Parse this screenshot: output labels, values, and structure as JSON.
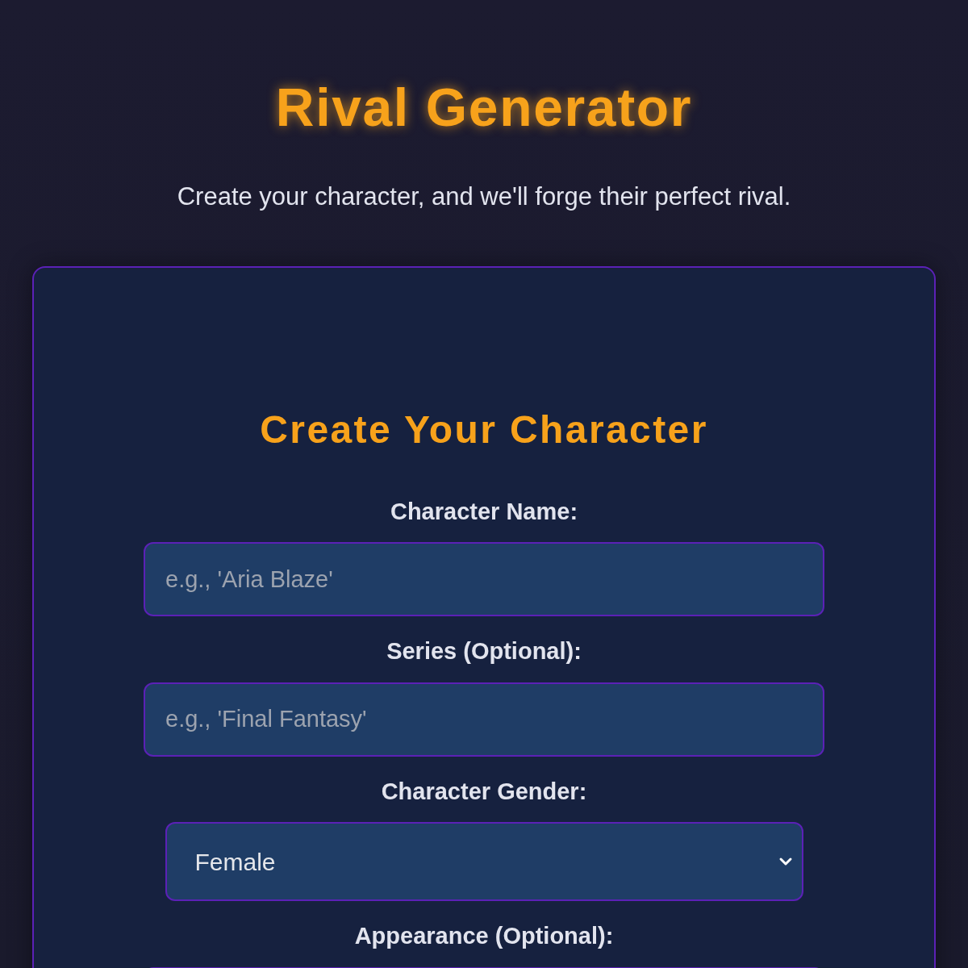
{
  "header": {
    "title": "Rival Generator",
    "subtitle": "Create your character, and we'll forge their perfect rival."
  },
  "form": {
    "heading": "Create Your Character",
    "fields": [
      {
        "kind": "text",
        "label": "Character Name:",
        "placeholder": "e.g., 'Aria Blaze'"
      },
      {
        "kind": "text",
        "label": "Series (Optional):",
        "placeholder": "e.g., 'Final Fantasy'"
      },
      {
        "kind": "select",
        "label": "Character Gender:",
        "value": "Female"
      },
      {
        "kind": "textarea",
        "label": "Appearance (Optional):"
      }
    ]
  }
}
